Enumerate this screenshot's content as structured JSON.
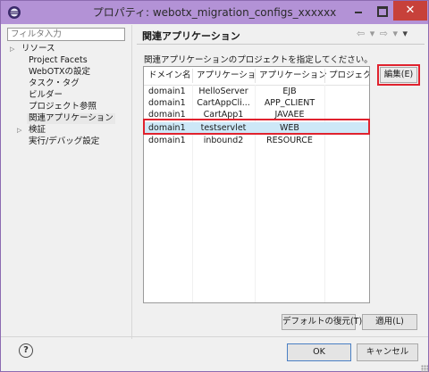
{
  "window": {
    "title": "プロパティ: webotx_migration_configs_xxxxxx",
    "close_glyph": "✕"
  },
  "sidebar": {
    "filter_placeholder": "フィルタ入力",
    "items": [
      {
        "label": "リソース",
        "expandable": true
      },
      {
        "label": "Project Facets",
        "expandable": false
      },
      {
        "label": "WebOTXの設定",
        "expandable": false
      },
      {
        "label": "タスク・タグ",
        "expandable": false
      },
      {
        "label": "ビルダー",
        "expandable": false
      },
      {
        "label": "プロジェクト参照",
        "expandable": false
      },
      {
        "label": "関連アプリケーション",
        "expandable": false,
        "selected": true
      },
      {
        "label": "検証",
        "expandable": true
      },
      {
        "label": "実行/デバッグ設定",
        "expandable": false
      }
    ]
  },
  "page": {
    "title": "関連アプリケーション",
    "nav_arrows": "⇦ ▾ ⇨ ▾",
    "menu_arrow": "▾",
    "description": "関連アプリケーションのプロジェクトを指定してください。"
  },
  "table": {
    "columns": [
      "ドメイン名",
      "アプリケーショ...",
      "アプリケーションタ...",
      "プロジェク..."
    ],
    "rows": [
      [
        "domain1",
        "HelloServer",
        "EJB",
        ""
      ],
      [
        "domain1",
        "CartAppCli...",
        "APP_CLIENT",
        ""
      ],
      [
        "domain1",
        "CartApp1",
        "JAVAEE",
        ""
      ],
      [
        "domain1",
        "testservlet",
        "WEB",
        ""
      ],
      [
        "domain1",
        "inbound2",
        "RESOURCE",
        ""
      ]
    ],
    "selected_row": 3
  },
  "buttons": {
    "edit": "編集(E)",
    "restore_defaults": "デフォルトの復元(T)",
    "apply": "適用(L)",
    "ok": "OK",
    "cancel": "キャンセル",
    "help": "?"
  },
  "colors": {
    "titlebar": "#b392d6",
    "selection": "#cde8f7",
    "highlight": "#e0222e",
    "close_button": "#c7413a"
  }
}
